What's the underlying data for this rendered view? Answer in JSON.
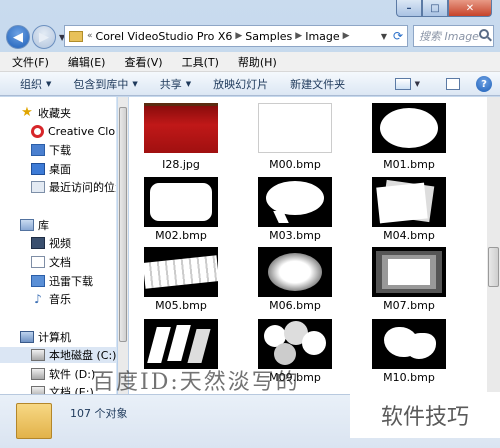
{
  "window": {
    "controls": {
      "minimize": "–",
      "maximize": "□",
      "close": "✕"
    }
  },
  "address": {
    "prefix": "«",
    "crumbs": [
      "Corel VideoStudio Pro X6",
      "Samples",
      "Image"
    ],
    "search_placeholder": "搜索 Image"
  },
  "menubar": [
    "文件(F)",
    "编辑(E)",
    "查看(V)",
    "工具(T)",
    "帮助(H)"
  ],
  "toolbar": [
    "组织",
    "包含到库中",
    "共享",
    "放映幻灯片",
    "新建文件夹"
  ],
  "sidebar": {
    "favorites_label": "收藏夹",
    "favorites": [
      "Creative Cloud",
      "下载",
      "桌面",
      "最近访问的位置"
    ],
    "library_label": "库",
    "library": [
      "视频",
      "文档",
      "迅雷下载",
      "音乐"
    ],
    "computer_label": "计算机",
    "drives": [
      "本地磁盘 (C:)",
      "软件 (D:)",
      "文档 (E:)"
    ]
  },
  "files": [
    {
      "name": "I28.jpg",
      "icon": "red-texture-thumbnail"
    },
    {
      "name": "M00.bmp",
      "icon": "white-mask-thumbnail"
    },
    {
      "name": "M01.bmp",
      "icon": "oval-mask-thumbnail"
    },
    {
      "name": "M02.bmp",
      "icon": "rounded-rect-mask-thumbnail"
    },
    {
      "name": "M03.bmp",
      "icon": "speech-bubble-mask-thumbnail"
    },
    {
      "name": "M04.bmp",
      "icon": "photo-stack-mask-thumbnail"
    },
    {
      "name": "M05.bmp",
      "icon": "film-strip-mask-thumbnail"
    },
    {
      "name": "M06.bmp",
      "icon": "soft-oval-mask-thumbnail"
    },
    {
      "name": "M07.bmp",
      "icon": "layered-rect-mask-thumbnail"
    },
    {
      "name": "M08.bmp",
      "icon": "shards-mask-thumbnail"
    },
    {
      "name": "M09.bmp",
      "icon": "circles-mask-thumbnail"
    },
    {
      "name": "M10.bmp",
      "icon": "splat-mask-thumbnail"
    }
  ],
  "status": {
    "count": "107 个对象"
  },
  "watermarks": {
    "left": "百度ID:天然淡写的",
    "right": "软件技巧"
  }
}
